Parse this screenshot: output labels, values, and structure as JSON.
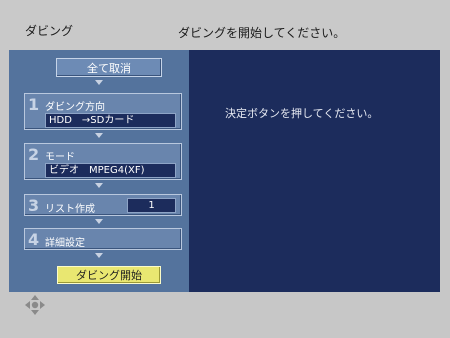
{
  "header": {
    "title": "ダビング",
    "instruction": "ダビングを開始してください。"
  },
  "left_panel": {
    "clear_all_label": "全て取消",
    "steps": [
      {
        "num": "1",
        "label": "ダビング方向",
        "value": "HDD　→SDカード"
      },
      {
        "num": "2",
        "label": "モード",
        "value": "ビデオ　MPEG4(XF)"
      },
      {
        "num": "3",
        "label": "リスト作成",
        "value": "1"
      },
      {
        "num": "4",
        "label": "詳細設定"
      }
    ],
    "start_label": "ダビング開始"
  },
  "right_panel": {
    "message": "決定ボタンを押してください。"
  },
  "footer": {
    "nav_icon": "dpad-icon"
  },
  "colors": {
    "left_panel_bg": "#54739d",
    "right_panel_bg": "#1c2c5c",
    "start_button": "#e9e771",
    "step_button": "#6985ad"
  }
}
